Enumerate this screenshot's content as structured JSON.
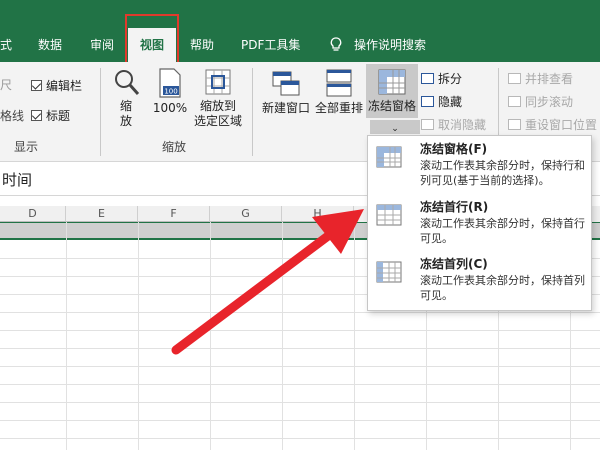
{
  "menubar": {
    "tabs": [
      {
        "label": "式"
      },
      {
        "label": "数据"
      },
      {
        "label": "审阅"
      },
      {
        "label": "视图"
      },
      {
        "label": "帮助"
      },
      {
        "label": "PDF工具集"
      },
      {
        "label": "操作说明搜索"
      }
    ]
  },
  "ribbon": {
    "show_group": {
      "partial_top": "尺",
      "partial_mid": "格线",
      "formula_bar": "编辑栏",
      "headings": "标题",
      "label": "显示"
    },
    "zoom_group": {
      "zoom": "缩\n放",
      "hundred": "100%",
      "zoom_to_selection_line1": "缩放到",
      "zoom_to_selection_line2": "选定区域",
      "label": "缩放",
      "hundred_icon_text": "100"
    },
    "window_group": {
      "new_window": "新建窗口",
      "arrange_all": "全部重排",
      "freeze_panes": "冻结窗格",
      "split": "拆分",
      "hide": "隐藏",
      "unhide": "取消隐藏",
      "view_side_by_side": "并排查看",
      "sync_scroll": "同步滚动",
      "reset_window_position": "重设窗口位置"
    }
  },
  "formula_bar": {
    "text": "时间"
  },
  "sheet": {
    "columns": [
      "D",
      "E",
      "F",
      "G",
      "H"
    ]
  },
  "freeze_menu": {
    "items": [
      {
        "title": "冻结窗格(F)",
        "desc": "滚动工作表其余部分时，保持行和列可见(基于当前的选择)。"
      },
      {
        "title": "冻结首行(R)",
        "desc": "滚动工作表其余部分时，保持首行可见。"
      },
      {
        "title": "冻结首列(C)",
        "desc": "滚动工作表其余部分时，保持首列可见。"
      }
    ]
  },
  "colors": {
    "excel_green": "#217346",
    "highlight_red": "#e03a2c",
    "arrow_red": "#e8242b"
  }
}
